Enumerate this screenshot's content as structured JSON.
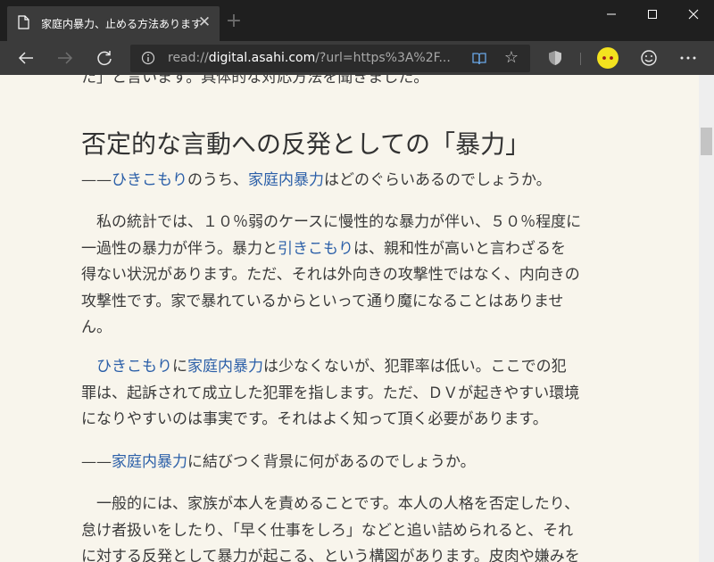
{
  "tab": {
    "title": "家庭内暴力、止める方法あります",
    "close_glyph": "✕",
    "newtab_glyph": "+"
  },
  "window": {
    "minimize_icon": "minimize-icon",
    "maximize_icon": "maximize-icon",
    "close_icon": "close-icon"
  },
  "nav": {
    "url_domain_prefix": "read://",
    "url_domain": "digital.asahi.com",
    "url_rest": "/?url=https%3A%2F...",
    "favorite_glyph": "☆"
  },
  "article": {
    "cut_line": "た」と言います。具体的な対応方法を聞きました。",
    "heading": "否定的な言動への反発としての「暴力」",
    "q1": {
      "dash": "——",
      "link1": "ひきこもり",
      "mid": "のうち、",
      "link2": "家庭内暴力",
      "rest": "はどのぐらいあるのでしょうか。"
    },
    "p1": {
      "l1": "　私の統計では、１０％弱のケースに慢性的な暴力が伴い、５０％程度に",
      "l2a": "一過性の暴力が伴う。暴力と",
      "l2link": "引きこもり",
      "l2b": "は、親和性が高いと言わざるを",
      "l3": "得ない状況があります。ただ、それは外向きの攻撃性ではなく、内向きの",
      "l4": "攻撃性です。家で暴れているからといって通り魔になることはありませ",
      "l5": "ん。"
    },
    "p2": {
      "l1indent": "　",
      "l1link1": "ひきこもり",
      "l1a": "に",
      "l1link2": "家庭内暴力",
      "l1b": "は少なくないが、犯罪率は低い。ここでの犯",
      "l2": "罪は、起訴されて成立した犯罪を指します。ただ、ＤＶが起きやすい環境",
      "l3": "になりやすいのは事実です。それはよく知って頂く必要があります。"
    },
    "q2": {
      "dash": "——",
      "link": "家庭内暴力",
      "rest": "に結びつく背景に何があるのでしょうか。"
    },
    "p3": {
      "l1": "　一般的には、家族が本人を責めることです。本人の人格を否定したり、",
      "l2": "怠け者扱いをしたり、「早く仕事をしろ」などと追い詰められると、それ",
      "l3": "に対する反発として暴力が起こる、という構図があります。皮肉や嫌みを"
    }
  }
}
